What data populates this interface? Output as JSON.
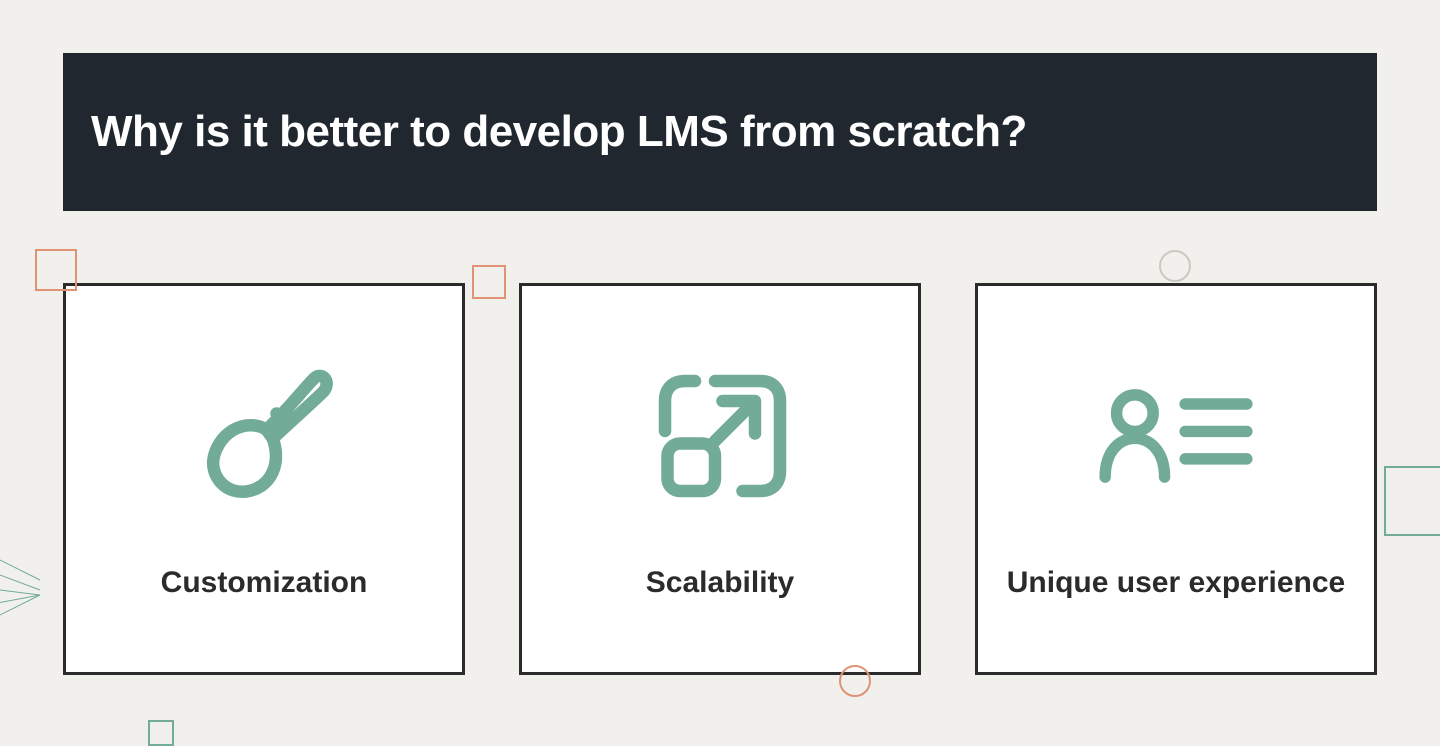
{
  "title": "Why is it better to develop LMS from scratch?",
  "cards": [
    {
      "label": "Customization",
      "icon": "brush-icon"
    },
    {
      "label": "Scalability",
      "icon": "expand-icon"
    },
    {
      "label": "Unique user experience",
      "icon": "user-list-icon"
    }
  ],
  "colors": {
    "accent_green": "#72ab97",
    "accent_orange": "#e09274",
    "bg": "#f1f0ec",
    "title_bg": "#20272f",
    "card_border": "#2b2b2b"
  }
}
